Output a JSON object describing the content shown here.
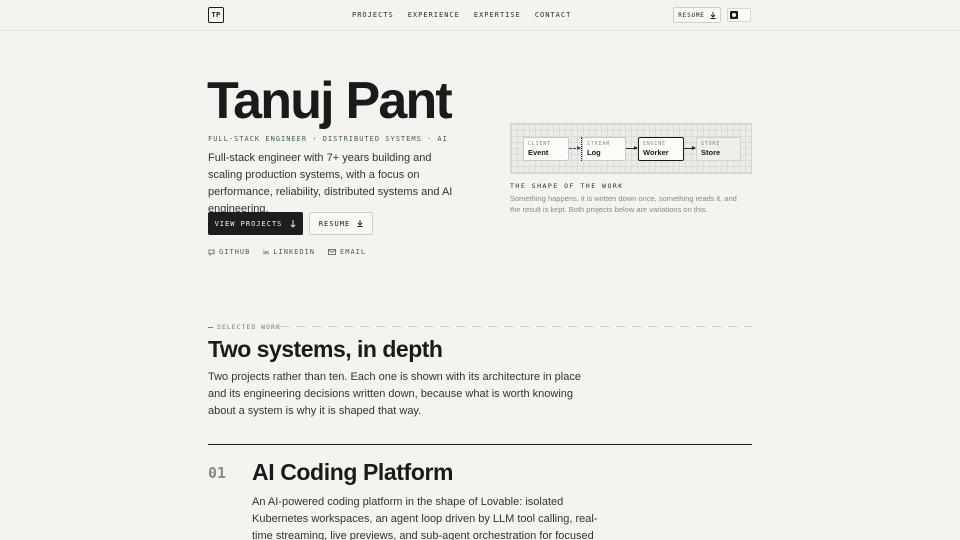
{
  "header": {
    "logo": "TP",
    "nav": [
      "PROJECTS",
      "EXPERIENCE",
      "EXPERTISE",
      "CONTACT"
    ],
    "resume_label": "RESUME"
  },
  "hero": {
    "name": "Tanuj Pant",
    "tagline": "FULL-STACK ENGINEER · DISTRIBUTED SYSTEMS · AI",
    "intro": "Full-stack engineer with 7+ years building and scaling production systems, with a focus on performance, reliability, distributed systems and AI engineering.",
    "primary_button": "VIEW PROJECTS",
    "secondary_button": "RESUME",
    "socials": [
      "GITHUB",
      "LINKEDIN",
      "EMAIL"
    ]
  },
  "diagram": {
    "nodes": [
      {
        "kind": "CLIENT",
        "value": "Event"
      },
      {
        "kind": "STREAM",
        "value": "Log"
      },
      {
        "kind": "ENGINE",
        "value": "Worker"
      },
      {
        "kind": "STORE",
        "value": "Store"
      }
    ],
    "title": "THE SHAPE OF THE WORK",
    "description": "Something happens, it is written down once, something reads it, and the result is kept. Both projects below are variations on this."
  },
  "work": {
    "label": "SELECTED WORK",
    "title": "Two systems, in depth",
    "description": "Two projects rather than ten. Each one is shown with its architecture in place and its engineering decisions written down, because what is worth knowing about a system is why it is shaped that way.",
    "projects": [
      {
        "number": "01",
        "title": "AI Coding Platform",
        "description": "An AI-powered coding platform in the shape of Lovable: isolated Kubernetes workspaces, an agent loop driven by LLM tool calling, real-time streaming, live previews, and sub-agent orchestration for focused work."
      }
    ]
  },
  "colors": {
    "background": "#f4f3ef",
    "text": "#1a1a18",
    "accent_green": "#2e6b4a",
    "muted": "#8a8984"
  }
}
